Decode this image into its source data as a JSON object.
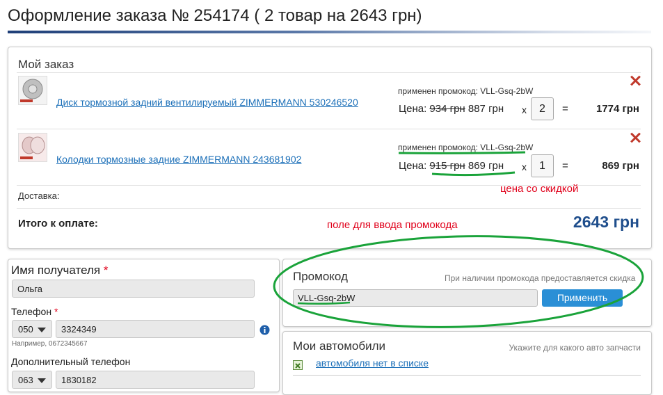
{
  "header": {
    "title": "Оформление заказа № 254174 ( 2 товар на 2643 грн)"
  },
  "order": {
    "title": "Мой заказ",
    "price_label": "Цена:",
    "multiply_sign": "x",
    "equals_sign": "=",
    "items": [
      {
        "name": "Диск тормозной задний вентилируемый ZIMMERMANN 530246520",
        "promo": "применен промокод: VLL-Gsq-2bW",
        "old_price": "934 грн",
        "new_price": "887 грн",
        "qty": "2",
        "total": "1774 грн"
      },
      {
        "name": "Колодки тормозные задние ZIMMERMANN 243681902",
        "promo": "применен промокод: VLL-Gsq-2bW",
        "old_price": "915 грн",
        "new_price": "869 грн",
        "qty": "1",
        "total": "869 грн"
      }
    ],
    "delivery_label": "Доставка:",
    "total_label": "Итого к оплате:",
    "total_value": "2643 грн"
  },
  "annotations": {
    "discount": "цена со скидкой",
    "promo_field": "поле для ввода промокода"
  },
  "recipient": {
    "name_label": "Имя получателя",
    "required_mark": "*",
    "name_value": "Ольга",
    "phone_label": "Телефон",
    "phone_code": "050",
    "phone_number": "3324349",
    "phone_hint": "Например, 0672345667",
    "extra_phone_label": "Дополнительный телефон",
    "extra_phone_code": "063",
    "extra_phone_number": "1830182"
  },
  "promo": {
    "title": "Промокод",
    "hint": "При наличии промокода предоставляется скидка",
    "value": "VLL-Gsq-2bW",
    "apply_label": "Применить"
  },
  "cars": {
    "title": "Мои автомобили",
    "hint": "Укажите для какого авто запчасти",
    "link": "автомобиля нет в списке"
  },
  "colors": {
    "accent_blue": "#1f4e8c",
    "link_blue": "#1b6fb8",
    "button_blue": "#2a8fd6",
    "annotation_red": "#e0001a",
    "annotation_green": "#1aa33a"
  }
}
